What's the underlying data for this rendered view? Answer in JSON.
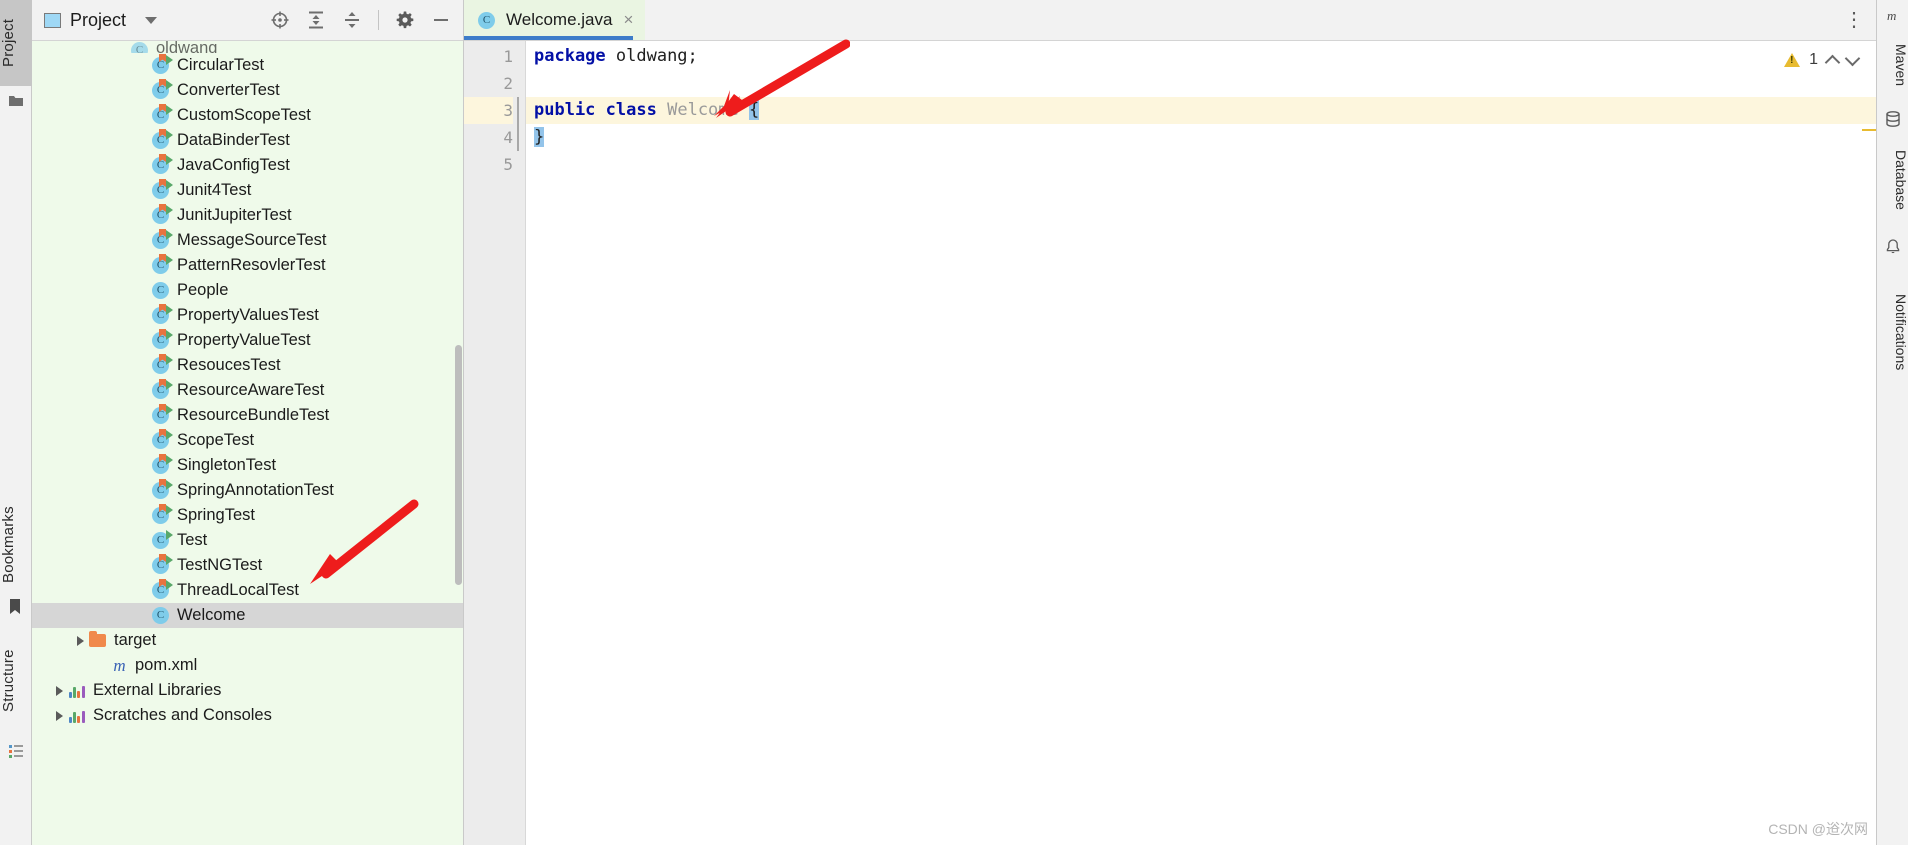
{
  "left_strip": {
    "tabs": [
      {
        "label": "Project",
        "icon": "project-icon",
        "active": true
      },
      {
        "label": "Bookmarks",
        "icon": "bookmark-icon",
        "active": false
      },
      {
        "label": "Structure",
        "icon": "structure-icon",
        "active": false
      }
    ]
  },
  "right_strip": {
    "tabs": [
      {
        "label": "Maven",
        "icon": "maven-icon"
      },
      {
        "label": "Database",
        "icon": "database-icon"
      },
      {
        "label": "Notifications",
        "icon": "notifications-icon"
      }
    ]
  },
  "project_panel": {
    "title": "Project",
    "dropdown_icon": "chevron-down-icon",
    "actions": [
      {
        "name": "select-opened-file-icon",
        "tooltip": "Select Opened File"
      },
      {
        "name": "expand-all-icon",
        "tooltip": "Expand All"
      },
      {
        "name": "collapse-all-icon",
        "tooltip": "Collapse All"
      },
      {
        "name": "settings-gear-icon",
        "tooltip": "Settings"
      },
      {
        "name": "hide-panel-icon",
        "tooltip": "Hide"
      }
    ],
    "tree": [
      {
        "label": "oldwang",
        "icon": "package-icon",
        "type": "cut",
        "indent": 3,
        "twisty": false,
        "selected": false
      },
      {
        "label": "CircularTest",
        "icon": "class-run-icon",
        "type": "class",
        "indent": 4,
        "twisty": false,
        "selected": false
      },
      {
        "label": "ConverterTest",
        "icon": "class-run-icon",
        "type": "class",
        "indent": 4,
        "twisty": false,
        "selected": false
      },
      {
        "label": "CustomScopeTest",
        "icon": "class-run-icon",
        "type": "class",
        "indent": 4,
        "twisty": false,
        "selected": false
      },
      {
        "label": "DataBinderTest",
        "icon": "class-run-icon",
        "type": "class",
        "indent": 4,
        "twisty": false,
        "selected": false
      },
      {
        "label": "JavaConfigTest",
        "icon": "class-run-icon",
        "type": "class",
        "indent": 4,
        "twisty": false,
        "selected": false
      },
      {
        "label": "Junit4Test",
        "icon": "class-run-icon",
        "type": "class",
        "indent": 4,
        "twisty": false,
        "selected": false
      },
      {
        "label": "JunitJupiterTest",
        "icon": "class-run-icon",
        "type": "class",
        "indent": 4,
        "twisty": false,
        "selected": false
      },
      {
        "label": "MessageSourceTest",
        "icon": "class-run-icon",
        "type": "class",
        "indent": 4,
        "twisty": false,
        "selected": false
      },
      {
        "label": "PatternResovlerTest",
        "icon": "class-run-icon",
        "type": "class",
        "indent": 4,
        "twisty": false,
        "selected": false
      },
      {
        "label": "People",
        "icon": "class-icon",
        "type": "class-plain",
        "indent": 4,
        "twisty": false,
        "selected": false
      },
      {
        "label": "PropertyValuesTest",
        "icon": "class-run-icon",
        "type": "class",
        "indent": 4,
        "twisty": false,
        "selected": false
      },
      {
        "label": "PropertyValueTest",
        "icon": "class-run-icon",
        "type": "class",
        "indent": 4,
        "twisty": false,
        "selected": false
      },
      {
        "label": "ResoucesTest",
        "icon": "class-run-icon",
        "type": "class",
        "indent": 4,
        "twisty": false,
        "selected": false
      },
      {
        "label": "ResourceAwareTest",
        "icon": "class-run-icon",
        "type": "class",
        "indent": 4,
        "twisty": false,
        "selected": false
      },
      {
        "label": "ResourceBundleTest",
        "icon": "class-run-icon",
        "type": "class",
        "indent": 4,
        "twisty": false,
        "selected": false
      },
      {
        "label": "ScopeTest",
        "icon": "class-run-icon",
        "type": "class",
        "indent": 4,
        "twisty": false,
        "selected": false
      },
      {
        "label": "SingletonTest",
        "icon": "class-run-icon",
        "type": "class",
        "indent": 4,
        "twisty": false,
        "selected": false
      },
      {
        "label": "SpringAnnotationTest",
        "icon": "class-run-icon",
        "type": "class",
        "indent": 4,
        "twisty": false,
        "selected": false
      },
      {
        "label": "SpringTest",
        "icon": "class-run-icon",
        "type": "class",
        "indent": 4,
        "twisty": false,
        "selected": false
      },
      {
        "label": "Test",
        "icon": "class-run-icon",
        "type": "class-green",
        "indent": 4,
        "twisty": false,
        "selected": false
      },
      {
        "label": "TestNGTest",
        "icon": "class-run-icon",
        "type": "class",
        "indent": 4,
        "twisty": false,
        "selected": false
      },
      {
        "label": "ThreadLocalTest",
        "icon": "class-run-icon",
        "type": "class",
        "indent": 4,
        "twisty": false,
        "selected": false
      },
      {
        "label": "Welcome",
        "icon": "class-icon",
        "type": "class-plain",
        "indent": 4,
        "twisty": false,
        "selected": true
      },
      {
        "label": "target",
        "icon": "folder-icon",
        "type": "folder",
        "indent": 1,
        "twisty": true,
        "selected": false
      },
      {
        "label": "pom.xml",
        "icon": "maven-file-icon",
        "type": "maven",
        "indent": 2,
        "twisty": false,
        "selected": false
      },
      {
        "label": "External Libraries",
        "icon": "libraries-icon",
        "type": "lib",
        "indent": 0,
        "twisty": true,
        "selected": false
      },
      {
        "label": "Scratches and Consoles",
        "icon": "scratches-icon",
        "type": "scratch",
        "indent": 0,
        "twisty": true,
        "selected": false
      }
    ]
  },
  "editor": {
    "tabs": [
      {
        "label": "Welcome.java",
        "icon": "java-class-icon",
        "close_label": "×",
        "active": true
      }
    ],
    "more_options_label": "⋮",
    "inspections": {
      "warning_count": "1",
      "warning_icon": "warning-triangle-icon",
      "prev_icon": "chevron-up-icon",
      "next_icon": "chevron-down-icon"
    },
    "gutter_lines": [
      "1",
      "2",
      "3",
      "4",
      "5"
    ],
    "code_lines": [
      {
        "number": "1",
        "highlight": false,
        "tokens": [
          {
            "text": "package",
            "style": "kw"
          },
          {
            "text": " oldwang;",
            "style": "plain"
          }
        ]
      },
      {
        "number": "2",
        "highlight": false,
        "tokens": []
      },
      {
        "number": "3",
        "highlight": true,
        "tokens": [
          {
            "text": "public",
            "style": "kw"
          },
          {
            "text": " ",
            "style": "plain"
          },
          {
            "text": "class",
            "style": "kw"
          },
          {
            "text": " ",
            "style": "plain"
          },
          {
            "text": "Welcome",
            "style": "grayed"
          },
          {
            "text": " ",
            "style": "plain"
          },
          {
            "text": "{",
            "style": "brace-hl"
          }
        ]
      },
      {
        "number": "4",
        "highlight": false,
        "tokens": [
          {
            "text": "}",
            "style": "brace-hl"
          }
        ]
      },
      {
        "number": "5",
        "highlight": false,
        "tokens": []
      }
    ]
  },
  "annotations": {
    "arrows": [
      {
        "name": "arrow-to-class-declaration",
        "color": "#ee1c1c"
      },
      {
        "name": "arrow-to-threadlocaltest",
        "color": "#ee1c1c"
      }
    ]
  },
  "watermark": {
    "text": "CSDN @逧次网"
  },
  "colors": {
    "tree_bg": "#effaea",
    "selected_row": "#d6d6d6",
    "tab_active_bg": "#eaf5e2",
    "tab_underline": "#3d7cc9",
    "line_highlight": "#fdf6dd",
    "keyword": "#0310a6",
    "grayed_identifier": "#9a9a9a",
    "brace_match": "#93c4ea",
    "warning": "#e8bb30",
    "arrow_red": "#ee1c1c"
  }
}
